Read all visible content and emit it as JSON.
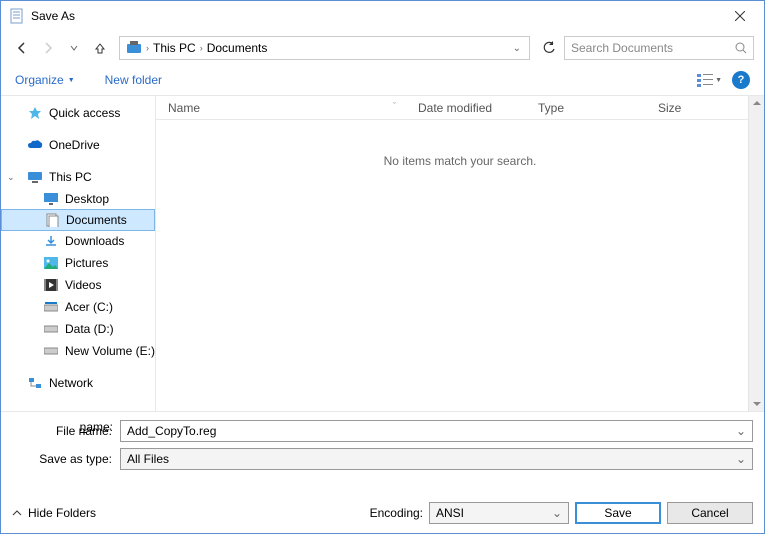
{
  "window": {
    "title": "Save As"
  },
  "breadcrumb": {
    "pc": "This PC",
    "docs": "Documents"
  },
  "search": {
    "placeholder": "Search Documents"
  },
  "toolbar": {
    "organize": "Organize",
    "new_folder": "New folder"
  },
  "sidebar": {
    "quick": "Quick access",
    "onedrive": "OneDrive",
    "thispc": "This PC",
    "desktop": "Desktop",
    "documents": "Documents",
    "downloads": "Downloads",
    "pictures": "Pictures",
    "videos": "Videos",
    "acer": "Acer (C:)",
    "data": "Data (D:)",
    "newvol": "New Volume (E:)",
    "network": "Network"
  },
  "columns": {
    "name": "Name",
    "date": "Date modified",
    "type": "Type",
    "size": "Size"
  },
  "empty_msg": "No items match your search.",
  "fields": {
    "filename_label": "File name:",
    "filename_value": "Add_CopyTo.reg",
    "type_label": "Save as type:",
    "type_value": "All Files"
  },
  "footer": {
    "hide": "Hide Folders",
    "encoding_label": "Encoding:",
    "encoding_value": "ANSI",
    "save": "Save",
    "cancel": "Cancel"
  }
}
